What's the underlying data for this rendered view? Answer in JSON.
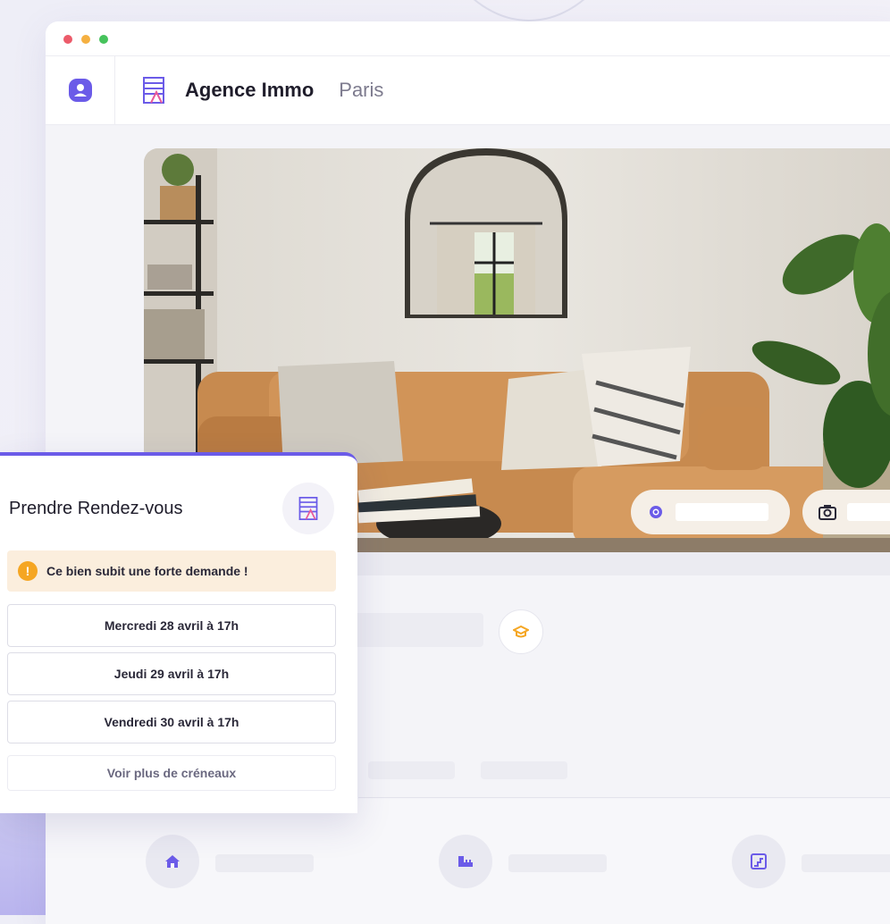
{
  "header": {
    "app_name": "Agence Immo",
    "city": "Paris"
  },
  "booking": {
    "title": "Prendre Rendez-vous",
    "alert": "Ce bien subit une forte demande !",
    "alert_symbol": "!",
    "slots": [
      "Mercredi 28 avril à 17h",
      "Jeudi 29 avril à 17h",
      "Vendredi 30 avril à 17h"
    ],
    "more_link": "Voir plus de créneaux"
  },
  "icons": {
    "user": "user-badge-icon",
    "building": "building-icon",
    "view": "eye-icon",
    "camera": "camera-icon",
    "education": "graduation-cap-icon",
    "home": "home-icon",
    "measure": "tape-measure-icon",
    "stairs": "stairs-icon"
  },
  "colors": {
    "accent": "#6b5be8",
    "warning": "#f5a623",
    "warning_bg": "#fbeedd",
    "pink_accent": "#e85b9a"
  }
}
